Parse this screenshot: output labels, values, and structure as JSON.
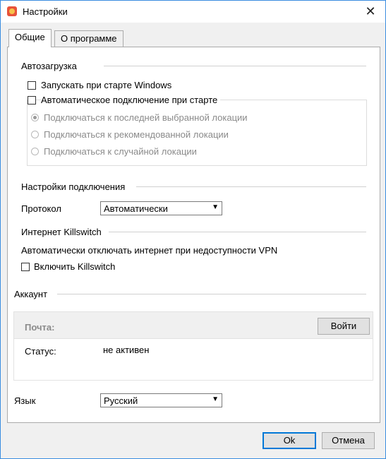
{
  "window": {
    "title": "Настройки",
    "close_glyph": "✕",
    "icon": "app-icon"
  },
  "tabs": [
    {
      "label": "Общие",
      "active": true
    },
    {
      "label": "О программе",
      "active": false
    }
  ],
  "autostart": {
    "section_title": "Автозагрузка",
    "start_with_windows": {
      "label": "Запускать при старте Windows",
      "checked": false
    },
    "auto_connect": {
      "label": "Автоматическое подключение при старте",
      "checked": false
    },
    "radios": [
      {
        "label": "Подключаться к последней выбранной локации",
        "checked": true,
        "enabled": false
      },
      {
        "label": "Подключаться к рекомендованной локации",
        "checked": false,
        "enabled": false
      },
      {
        "label": "Подключаться к случайной локации",
        "checked": false,
        "enabled": false
      }
    ]
  },
  "connection": {
    "section_title": "Настройки подключения",
    "protocol_label": "Протокол",
    "protocol_value": "Автоматически"
  },
  "killswitch": {
    "section_title": "Интернет Killswitch",
    "description": "Автоматически отключать интернет при недоступности VPN",
    "enable": {
      "label": "Включить Killswitch",
      "checked": false
    }
  },
  "account": {
    "section_title": "Аккаунт",
    "email_label": "Почта:",
    "login_button": "Войти",
    "status_label": "Статус:",
    "status_value": "не активен"
  },
  "language": {
    "label": "Язык",
    "value": "Русский"
  },
  "footer": {
    "ok_label": "Ok",
    "cancel_label": "Отмена"
  },
  "colors": {
    "window_border": "#3a8de0",
    "default_button_border": "#0078d7",
    "disabled_text": "#8a8a8a"
  }
}
